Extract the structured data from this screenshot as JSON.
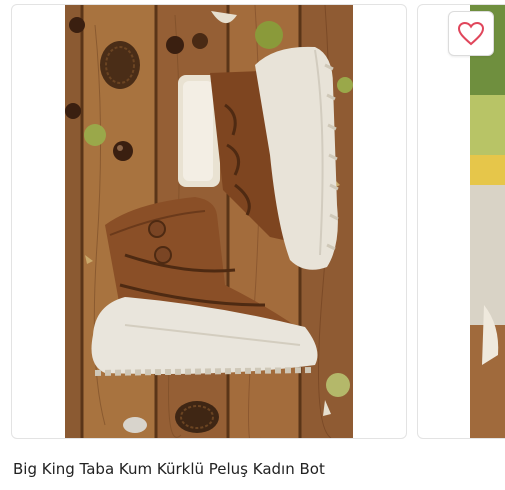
{
  "product": {
    "title": "Big King Taba Kum Kürklü Peluş Kadın Bot"
  },
  "favorite": {
    "icon": "heart-outline-icon",
    "color": "#e0465b"
  },
  "colors": {
    "wood": "#9c6a3e",
    "suede": "#8a4f27",
    "sole": "#e9e5dc"
  }
}
